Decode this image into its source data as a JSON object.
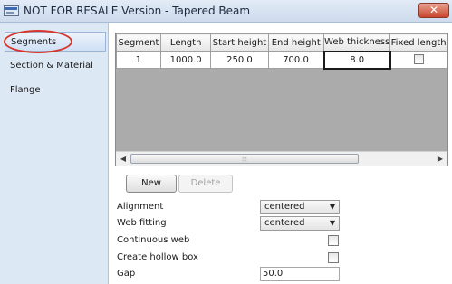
{
  "window": {
    "title": "NOT FOR RESALE Version - Tapered Beam",
    "close_glyph": "✕"
  },
  "sidebar": {
    "items": [
      {
        "label": "Segments",
        "selected": true
      },
      {
        "label": "Section & Material",
        "selected": false
      },
      {
        "label": "Flange",
        "selected": false
      }
    ]
  },
  "grid": {
    "columns": [
      "Segment",
      "Length",
      "Start height",
      "End height",
      "Web thickness",
      "Fixed length"
    ],
    "rows": [
      {
        "segment": "1",
        "length": "1000.0",
        "start_height": "250.0",
        "end_height": "700.0",
        "web_thickness": "8.0",
        "fixed_length": false
      }
    ],
    "scroll_grip": "⦙⦙⦙"
  },
  "buttons": {
    "new_label": "New",
    "delete_label": "Delete"
  },
  "properties": {
    "alignment": {
      "label": "Alignment",
      "value": "centered"
    },
    "web_fitting": {
      "label": "Web fitting",
      "value": "centered"
    },
    "continuous_web": {
      "label": "Continuous web",
      "checked": false
    },
    "create_hollow_box": {
      "label": "Create hollow box",
      "checked": false
    },
    "gap": {
      "label": "Gap",
      "value": "50.0"
    }
  },
  "icons": {
    "app": "beam-app-icon",
    "close": "close-icon",
    "dropdown": "chevron-down-icon",
    "scroll_left": "scroll-left-icon",
    "scroll_right": "scroll-right-icon"
  },
  "colors": {
    "annotation": "#d8352a",
    "sidebar_bg": "#dde8f5",
    "grid_empty_area": "#ababab"
  }
}
